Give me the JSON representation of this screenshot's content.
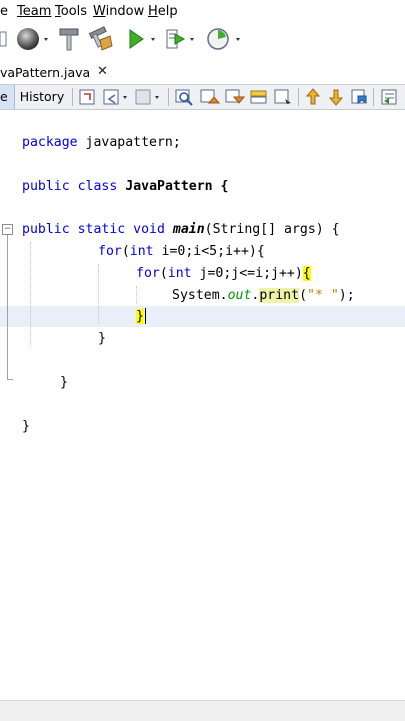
{
  "menubar": {
    "items": [
      {
        "prefix": "",
        "mnemonic": "",
        "rest": "e"
      },
      {
        "prefix": "",
        "mnemonic": "",
        "rest": "Team"
      },
      {
        "prefix": "",
        "mnemonic": "T",
        "rest": "ools"
      },
      {
        "prefix": "",
        "mnemonic": "W",
        "rest": "indow"
      },
      {
        "prefix": "",
        "mnemonic": "H",
        "rest": "elp"
      }
    ]
  },
  "tab": {
    "label": "vaPattern.java",
    "close_glyph": "✕"
  },
  "editor_toolbar": {
    "source_label": "e",
    "history_label": "History"
  },
  "code": {
    "line1": {
      "kw": "package",
      "rest": " javapattern;"
    },
    "line2": {
      "kw1": "public",
      "kw2": "class",
      "name": "JavaPattern {"
    },
    "line3": {
      "kw": "public static void",
      "method": "main",
      "rest": "(String[] args) {"
    },
    "line4": {
      "kw1": "for",
      "a": "(",
      "kw2": "int",
      "b": " i=0;i<5;i++){"
    },
    "line5": {
      "kw1": "for",
      "a": "(",
      "kw2": "int",
      "b": " j=0;j<=i;j++)",
      "brace": "{"
    },
    "line6": {
      "obj": "System.",
      "field": "out",
      "dot": ".",
      "call": "print",
      "open": "(",
      "str": "\"* \"",
      "close": ");"
    },
    "line7": {
      "brace": "}"
    },
    "line8": {
      "brace": "}"
    },
    "line9": {
      "brace": "}"
    },
    "line10": {
      "brace": "}"
    }
  },
  "colors": {
    "keyword": "#0000e6",
    "string": "#ce7b00",
    "field": "#009900",
    "brace_match": "#ffff00",
    "current_line": "#e9eff8"
  }
}
